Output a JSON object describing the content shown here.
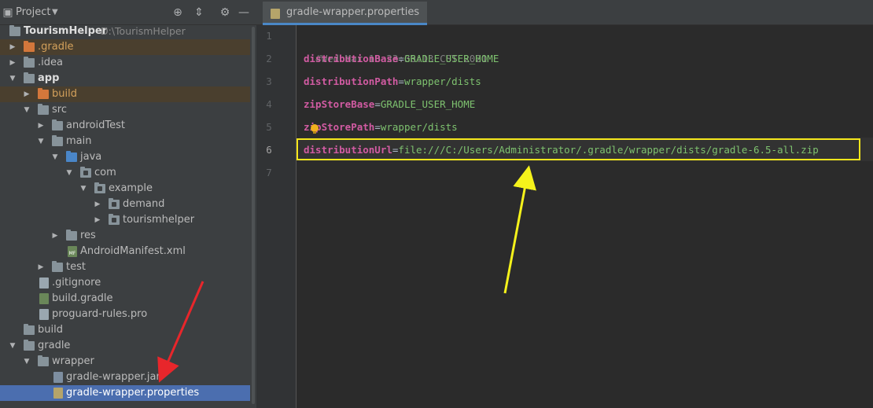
{
  "project_panel": {
    "title": "Project",
    "icons": [
      "locate-icon",
      "collapse-icon",
      "settings-icon",
      "hide-icon"
    ]
  },
  "tree": [
    {
      "label": "TourismHelper",
      "sub": "D:\\TourismHelper"
    },
    {
      "label": ".gradle"
    },
    {
      "label": ".idea"
    },
    {
      "label": "app"
    },
    {
      "label": "build"
    },
    {
      "label": "src"
    },
    {
      "label": "androidTest"
    },
    {
      "label": "main"
    },
    {
      "label": "java"
    },
    {
      "label": "com"
    },
    {
      "label": "example"
    },
    {
      "label": "demand"
    },
    {
      "label": "tourismhelper"
    },
    {
      "label": "res"
    },
    {
      "label": "AndroidManifest.xml",
      "icon_text": "MF"
    },
    {
      "label": "test"
    },
    {
      "label": ".gitignore"
    },
    {
      "label": "build.gradle"
    },
    {
      "label": "proguard-rules.pro"
    },
    {
      "label": "build"
    },
    {
      "label": "gradle"
    },
    {
      "label": "wrapper"
    },
    {
      "label": "gradle-wrapper.jar"
    },
    {
      "label": "gradle-wrapper.properties"
    }
  ],
  "editor": {
    "tab_label": "gradle-wrapper.properties",
    "line_numbers": [
      "1",
      "2",
      "3",
      "4",
      "5",
      "6",
      "7"
    ],
    "lines": [
      {
        "comment": "#Wed Mar 10 23:36:13 CST 2021"
      },
      {
        "key": "distributionBase",
        "eq": "=",
        "value": "GRADLE_USER_HOME"
      },
      {
        "key": "distributionPath",
        "eq": "=",
        "value": "wrapper/dists"
      },
      {
        "key": "zipStoreBase",
        "eq": "=",
        "value": "GRADLE_USER_HOME"
      },
      {
        "key": "zipStorePath",
        "eq": "=",
        "value": "wrapper/dists"
      },
      {
        "key": "distributionUrl",
        "eq": "=",
        "value": "file:///C:/Users/Administrator/.gradle/wrapper/dists/gradle-6.5-all.zip"
      },
      {
        "comment": ""
      }
    ]
  },
  "annotations": {
    "highlight_color": "#f5e61b",
    "red_arrow_color": "#e8262b",
    "yellow_arrow_color": "#f5f21b"
  }
}
